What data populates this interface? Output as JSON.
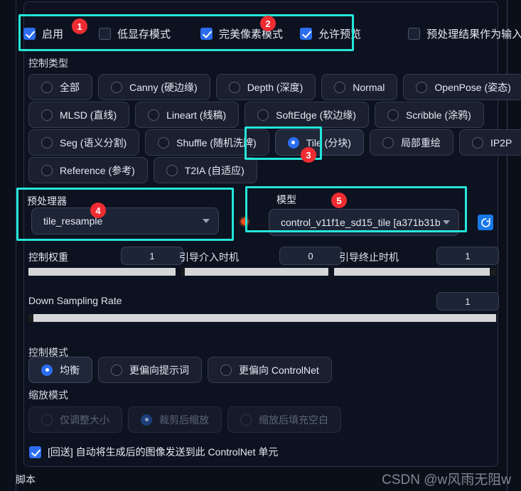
{
  "colors": {
    "background": "#0b0f19",
    "panel": "#0d1220",
    "accent_highlight": "#24e6d9",
    "badge_red": "#ef2c31",
    "checkbox_blue": "#2c6df0",
    "refresh_blue": "#1878e8",
    "slider_fill": "#d4d6d8",
    "text": "#e6e9f2",
    "text_dim": "#5d6478"
  },
  "toggles": {
    "items": [
      {
        "label": "启用",
        "checked": true
      },
      {
        "label": "低显存模式",
        "checked": false
      },
      {
        "label": "完美像素模式",
        "checked": true
      },
      {
        "label": "允许预览",
        "checked": true
      },
      {
        "label": "预处理结果作为输入",
        "checked": false
      }
    ]
  },
  "badges": {
    "one": "1",
    "two": "2",
    "three": "3",
    "four": "4",
    "five": "5"
  },
  "control_type": {
    "label": "控制类型",
    "rows": [
      [
        {
          "label": "全部",
          "selected": false
        },
        {
          "label": "Canny (硬边缘)",
          "selected": false
        },
        {
          "label": "Depth (深度)",
          "selected": false
        },
        {
          "label": "Normal",
          "selected": false
        },
        {
          "label": "OpenPose (姿态)",
          "selected": false
        }
      ],
      [
        {
          "label": "MLSD (直线)",
          "selected": false
        },
        {
          "label": "Lineart (线稿)",
          "selected": false
        },
        {
          "label": "SoftEdge (软边缘)",
          "selected": false
        },
        {
          "label": "Scribble (涂鸦)",
          "selected": false
        }
      ],
      [
        {
          "label": "Seg (语义分割)",
          "selected": false
        },
        {
          "label": "Shuffle (随机洗牌)",
          "selected": false
        },
        {
          "label": "Tile (分块)",
          "selected": true
        },
        {
          "label": "局部重绘",
          "selected": false
        },
        {
          "label": "IP2P",
          "selected": false
        }
      ],
      [
        {
          "label": "Reference (参考)",
          "selected": false
        },
        {
          "label": "T2IA (自适应)",
          "selected": false
        }
      ]
    ]
  },
  "preprocessor": {
    "label": "预处理器",
    "value": "tile_resample"
  },
  "model": {
    "label": "模型",
    "value": "control_v11f1e_sd15_tile [a371b31b"
  },
  "refresh": {
    "icon": "refresh-icon"
  },
  "starburst": {
    "icon": "starburst-icon",
    "glyph": "✸"
  },
  "sliders": [
    {
      "label": "控制权重",
      "value": "1",
      "fill_percent": 100
    },
    {
      "label": "引导介入时机",
      "value": "0",
      "fill_percent": 0
    },
    {
      "label": "引导终止时机",
      "value": "1",
      "fill_percent": 100
    },
    {
      "label": "Down Sampling Rate",
      "value": "1",
      "fill_percent": 0
    }
  ],
  "control_mode": {
    "label": "控制模式",
    "options": [
      {
        "label": "均衡",
        "selected": true
      },
      {
        "label": "更偏向提示词",
        "selected": false
      },
      {
        "label": "更偏向 ControlNet",
        "selected": false
      }
    ]
  },
  "scale_mode": {
    "label": "缩放模式",
    "disabled": true,
    "options": [
      {
        "label": "仅调整大小",
        "selected": false
      },
      {
        "label": "裁剪后缩放",
        "selected": true
      },
      {
        "label": "缩放后填充空白",
        "selected": false
      }
    ]
  },
  "loopback": {
    "label": "[回送] 自动将生成后的图像发送到此 ControlNet 单元",
    "checked": true
  },
  "footer": {
    "script_label": "脚本",
    "watermark": "CSDN @w风雨无阻w"
  }
}
